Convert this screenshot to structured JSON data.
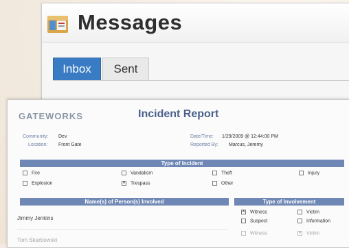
{
  "messages": {
    "title": "Messages",
    "tabs": [
      {
        "label": "Inbox"
      },
      {
        "label": "Sent"
      }
    ]
  },
  "report": {
    "logo": "GATEWORKS",
    "title": "Incident Report",
    "community_label": "Community:",
    "community_value": "Dev",
    "location_label": "Location:",
    "location_value": "Front Gate",
    "datetime_label": "Date/Time:",
    "datetime_value": "1/29/2009 @ 12:44:00 PM",
    "reported_label": "Reported By:",
    "reported_value": "Marcus, Jeremy",
    "incident_type_header": "Type of Incident",
    "incident_types": [
      {
        "label": "Fire",
        "checked": false
      },
      {
        "label": "Vandalism",
        "checked": false
      },
      {
        "label": "Theft",
        "checked": false
      },
      {
        "label": "Injury",
        "checked": false
      },
      {
        "label": "Explosion",
        "checked": false
      },
      {
        "label": "Trespass",
        "checked": true
      },
      {
        "label": "Other",
        "checked": false
      }
    ],
    "persons_header": "Name(s) of Person(s) Involved",
    "involvement_header": "Type of Involvement",
    "persons": [
      {
        "name": "Jimmy Jenkins"
      },
      {
        "name": "Tom Skarbowski"
      }
    ],
    "involvement": [
      {
        "label": "Witness",
        "checked": true
      },
      {
        "label": "Victim",
        "checked": false
      },
      {
        "label": "Suspect",
        "checked": false
      },
      {
        "label": "Information",
        "checked": false
      },
      {
        "label": "Witness",
        "checked": false
      },
      {
        "label": "Victim",
        "checked": true
      }
    ]
  }
}
